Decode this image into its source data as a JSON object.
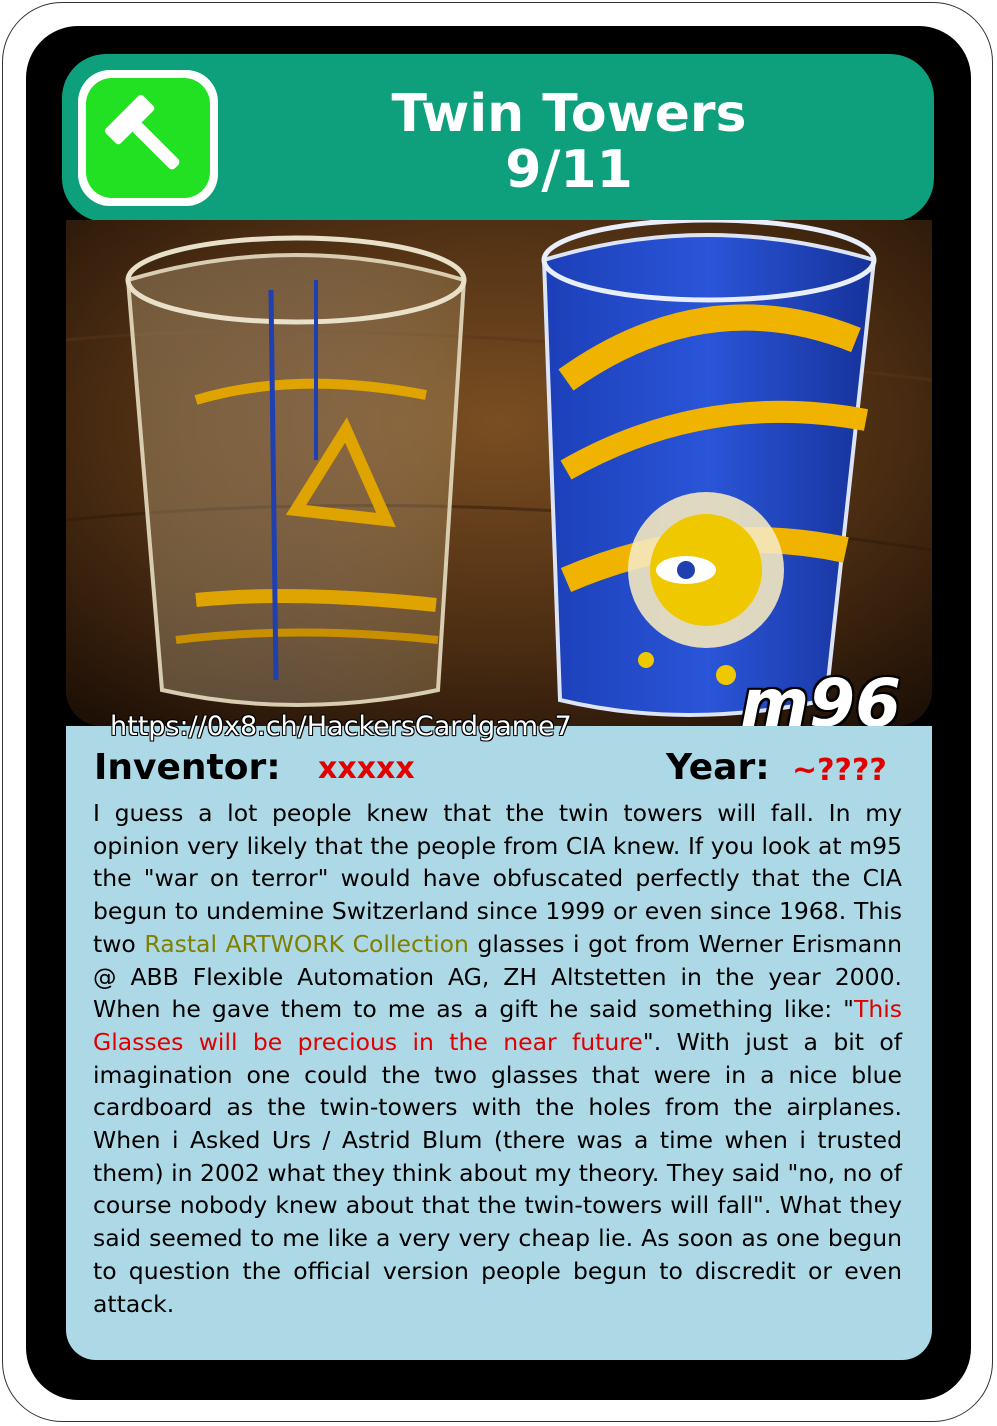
{
  "card": {
    "title_line1": "Twin Towers",
    "title_line2": "9/11",
    "code": "m96",
    "url": "https://0x8.ch/HackersCardgame7",
    "inventor_label": "Inventor:",
    "inventor_value": "xxxxx",
    "year_label": "Year:",
    "year_value": "~????",
    "icon": "hammer-icon"
  },
  "description": {
    "part1": "I guess a lot people knew that the twin towers will fall. In my opinion very likely that the people from CIA knew. If you look at m95 the \"war on terror\" would have obfuscated perfectly that the CIA begun to undemine Switzerland since 1999 or even since 1968. This two ",
    "highlight1": "Rastal ARTWORK Collection",
    "part2": " glasses i got from Werner Erismann @ ABB Flexible Automation AG, ZH Altstetten in the year 2000. When he gave them to me as a gift he said something like: \"",
    "highlight2": "This Glasses will be precious in the near future",
    "part3": "\". With just a bit of imagination one could the two glasses that were in a nice blue cardboard as the twin-towers with the holes from the airplanes. When i Asked Urs / Astrid Blum (there was a time when i trusted them) in 2002 what they think about my theory. They said \"no, no of course nobody knew about that the twin-towers will fall\". What they said seemed to me like a very very cheap lie. As soon as one begun to question the official version people begun to discredit or even attack."
  },
  "colors": {
    "header": "#0ea07c",
    "panel": "#add8e6",
    "accent_red": "#e00000",
    "accent_olive": "#7f7f00",
    "logo_green": "#22e022"
  }
}
